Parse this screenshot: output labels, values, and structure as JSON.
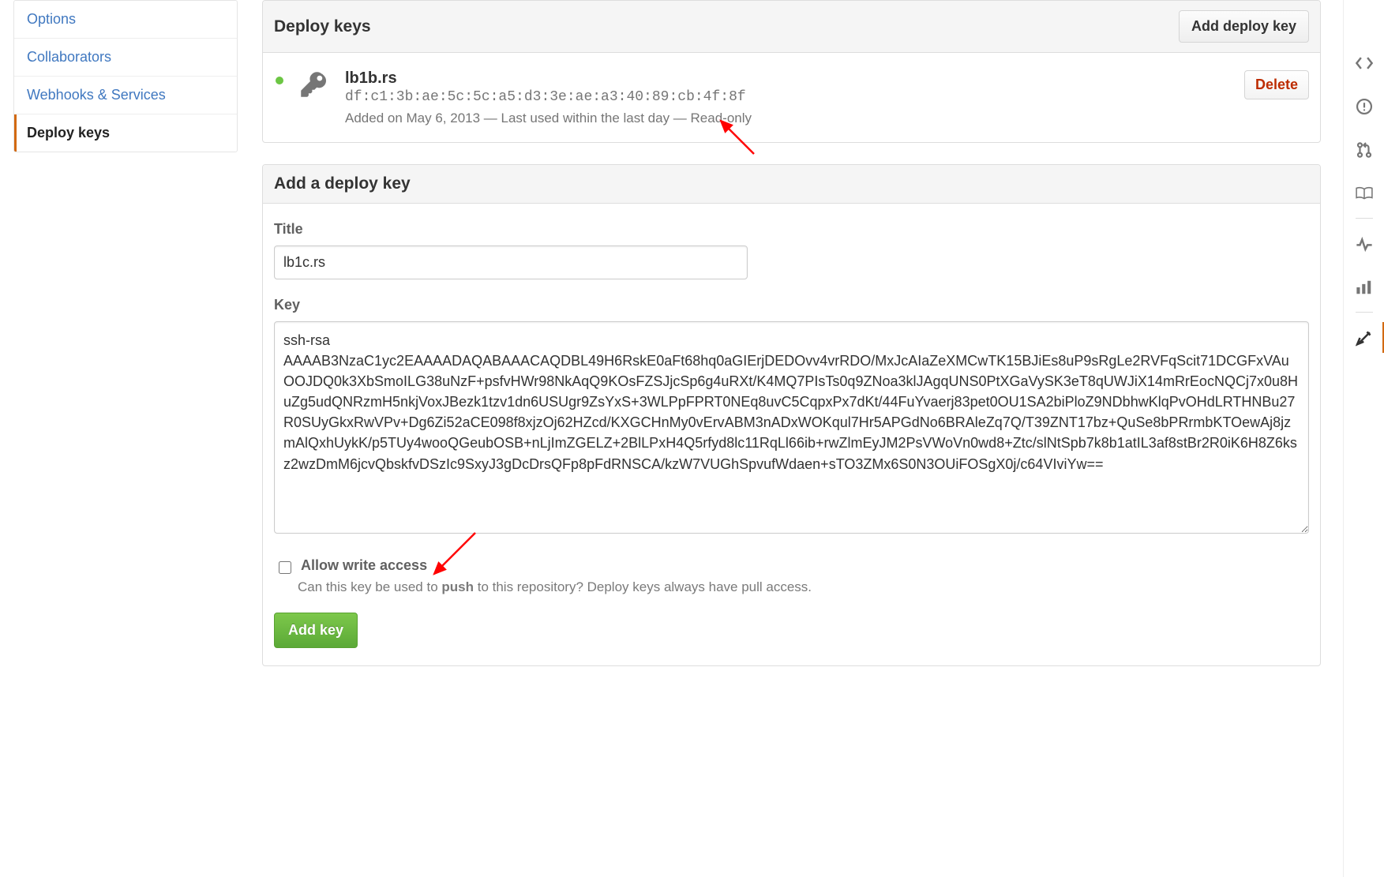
{
  "sidebar": {
    "items": [
      {
        "label": "Options"
      },
      {
        "label": "Collaborators"
      },
      {
        "label": "Webhooks & Services"
      },
      {
        "label": "Deploy keys"
      }
    ]
  },
  "deploy_keys_panel": {
    "title": "Deploy keys",
    "add_button": "Add deploy key",
    "key": {
      "name": "lb1b.rs",
      "fingerprint": "df:c1:3b:ae:5c:5c:a5:d3:3e:ae:a3:40:89:cb:4f:8f",
      "meta": "Added on May 6, 2013 — Last used within the last day — Read-only",
      "delete": "Delete"
    }
  },
  "add_panel": {
    "title": "Add a deploy key",
    "title_label": "Title",
    "title_value": "lb1c.rs",
    "key_label": "Key",
    "key_value": "ssh-rsa AAAAB3NzaC1yc2EAAAADAQABAAACAQDBL49H6RskE0aFt68hq0aGIErjDEDOvv4vrRDO/MxJcAIaZeXMCwTK15BJiEs8uP9sRgLe2RVFqScit71DCGFxVAuOOJDQ0k3XbSmoILG38uNzF+psfvHWr98NkAqQ9KOsFZSJjcSp6g4uRXt/K4MQ7PIsTs0q9ZNoa3klJAgqUNS0PtXGaVySK3eT8qUWJiX14mRrEocNQCj7x0u8HuZg5udQNRzmH5nkjVoxJBezk1tzv1dn6USUgr9ZsYxS+3WLPpFPRT0NEq8uvC5CqpxPx7dKt/44FuYvaerj83pet0OU1SA2biPloZ9NDbhwKlqPvOHdLRTHNBu27R0SUyGkxRwVPv+Dg6Zi52aCE098f8xjzOj62HZcd/KXGCHnMy0vErvABM3nADxWOKqul7Hr5APGdNo6BRAleZq7Q/T39ZNT17bz+QuSe8bPRrmbKTOewAj8jzmAlQxhUykK/p5TUy4wooQGeubOSB+nLjImZGELZ+2BlLPxH4Q5rfyd8lc11RqLl66ib+rwZlmEyJM2PsVWoVn0wd8+Ztc/slNtSpb7k8b1atIL3af8stBr2R0iK6H8Z6ksz2wzDmM6jcvQbskfvDSzIc9SxyJ3gDcDrsQFp8pFdRNSCA/kzW7VUGhSpvufWdaen+sTO3ZMx6S0N3OUiFOSgX0j/c64VIviYw==",
    "allow_write_label": "Allow write access",
    "allow_write_note_prefix": "Can this key be used to ",
    "allow_write_note_bold": "push",
    "allow_write_note_suffix": " to this repository? Deploy keys always have pull access.",
    "submit": "Add key"
  }
}
